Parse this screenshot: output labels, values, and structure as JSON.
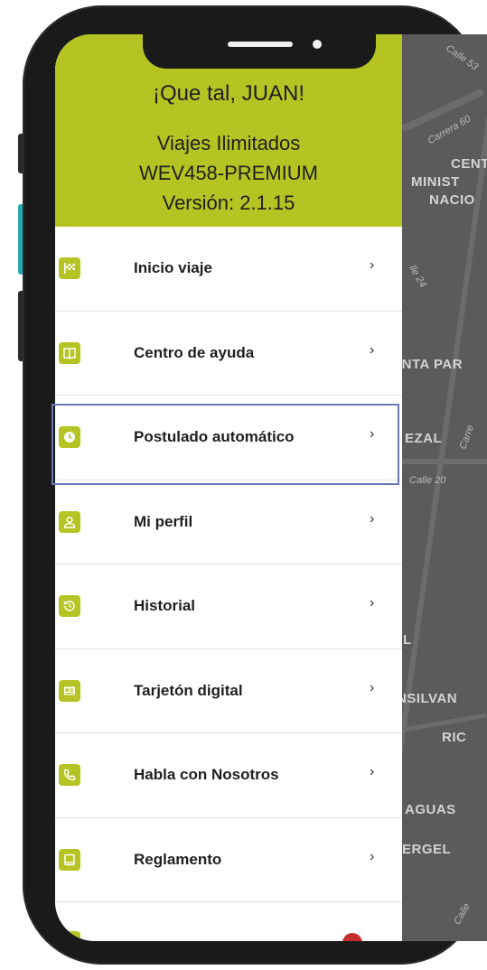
{
  "header": {
    "greeting": "¡Que tal, JUAN!",
    "plan_line1": "Viajes Ilimitados",
    "plan_line2": "WEV458-PREMIUM",
    "version": "Versión: 2.1.15"
  },
  "menu": {
    "items": [
      {
        "label": "Inicio viaje",
        "icon": "checkered-flag-icon"
      },
      {
        "label": "Centro de ayuda",
        "icon": "book-icon"
      },
      {
        "label": "Postulado automático",
        "icon": "clock-icon"
      },
      {
        "label": "Mi perfil",
        "icon": "user-icon"
      },
      {
        "label": "Historial",
        "icon": "history-icon"
      },
      {
        "label": "Tarjetón digital",
        "icon": "id-card-icon"
      },
      {
        "label": "Habla con Nosotros",
        "icon": "phone-icon"
      },
      {
        "label": "Reglamento",
        "icon": "book-closed-icon"
      }
    ],
    "chevron": "›"
  },
  "map": {
    "labels": [
      "CENT",
      "MINIST",
      "NACIO",
      "INTA PAR",
      "EZAL",
      "L",
      "NSILVAN",
      "RIC",
      "AGUAS",
      "ERGEL"
    ],
    "streets": [
      "Calle 53",
      "Carrera 60",
      "lle 24",
      "Carre",
      "Calle 20",
      "Calle"
    ]
  },
  "colors": {
    "accent": "#b5c423",
    "highlight_border": "#6a78b3",
    "map_bg": "#5a5b5a"
  }
}
